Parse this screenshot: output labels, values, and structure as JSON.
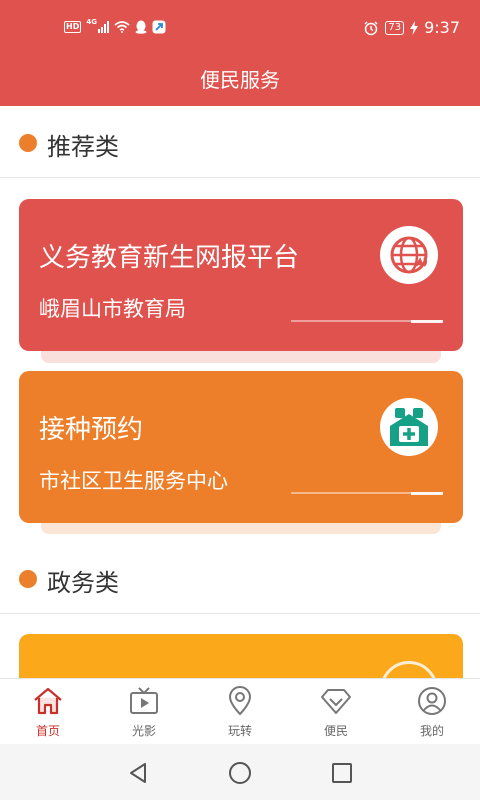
{
  "status_bar": {
    "hd_label": "HD",
    "network_label": "4G",
    "battery_level": "73",
    "time": "9:37"
  },
  "header": {
    "title": "便民服务"
  },
  "sections": [
    {
      "title": "推荐类"
    },
    {
      "title": "政务类"
    }
  ],
  "cards": [
    {
      "title": "义务教育新生网报平台",
      "subtitle": "峨眉山市教育局",
      "color": "#e0524d",
      "icon": "globe-signal-icon"
    },
    {
      "title": "接种预约",
      "subtitle": "市社区卫生服务中心",
      "color": "#ed7f2a",
      "icon": "medical-house-icon"
    },
    {
      "color": "#fba81b"
    }
  ],
  "tabs": [
    {
      "label": "首页",
      "icon": "home-icon",
      "active": true
    },
    {
      "label": "光影",
      "icon": "tv-play-icon"
    },
    {
      "label": "玩转",
      "icon": "location-pin-icon"
    },
    {
      "label": "便民",
      "icon": "diamond-icon"
    },
    {
      "label": "我的",
      "icon": "user-icon"
    }
  ],
  "colors": {
    "accent": "#e0524d",
    "active_tab": "#c9302c",
    "inactive_tab": "#666666",
    "section_dot": "#ec7f2c"
  }
}
